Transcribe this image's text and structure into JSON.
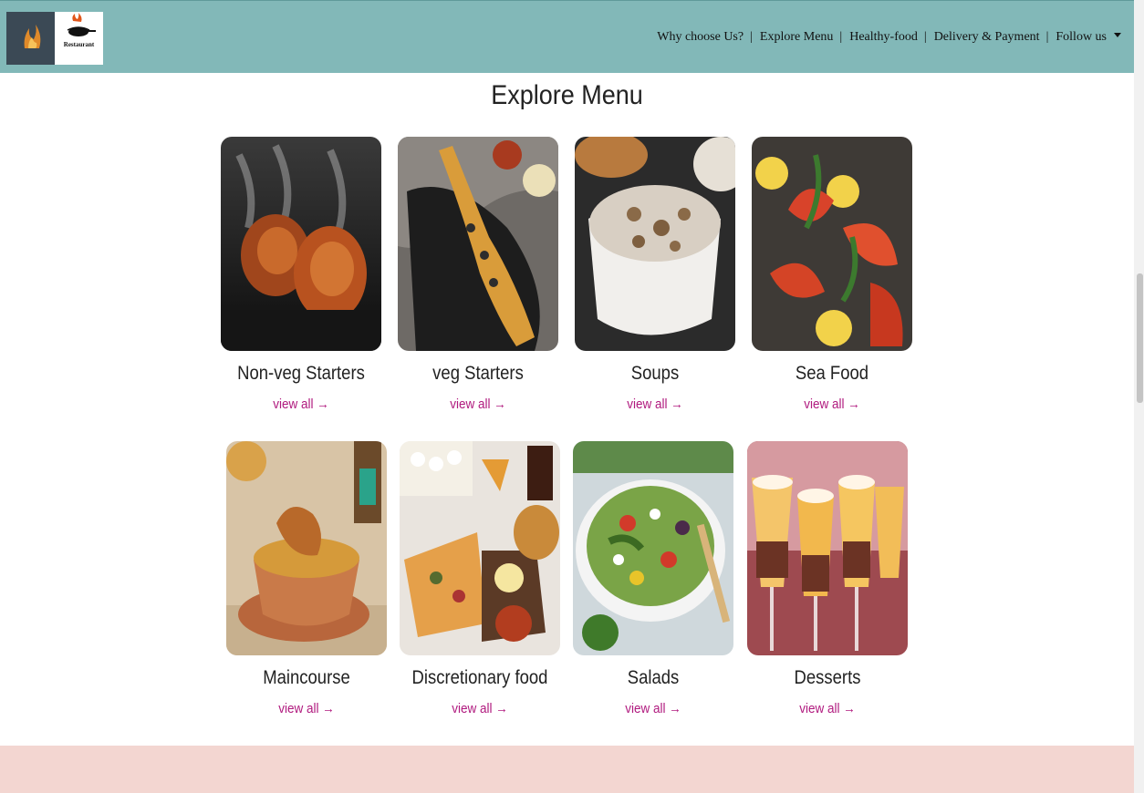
{
  "header": {
    "logo_text": "Restaurant",
    "nav": [
      {
        "label": "Why choose Us?"
      },
      {
        "label": "Explore Menu"
      },
      {
        "label": "Healthy-food"
      },
      {
        "label": "Delivery & Payment"
      },
      {
        "label": "Follow us"
      }
    ]
  },
  "menu": {
    "title": "Explore Menu",
    "link_label": "view all →",
    "items": [
      {
        "name": "Non-veg Starters"
      },
      {
        "name": "veg Starters"
      },
      {
        "name": "Soups"
      },
      {
        "name": "Sea Food"
      },
      {
        "name": "Maincourse"
      },
      {
        "name": "Discretionary food"
      },
      {
        "name": "Salads"
      },
      {
        "name": "Desserts"
      }
    ]
  },
  "colors": {
    "navbar": "#82b8b8",
    "link": "#b0197e",
    "footer_band": "#f3d6d1"
  }
}
